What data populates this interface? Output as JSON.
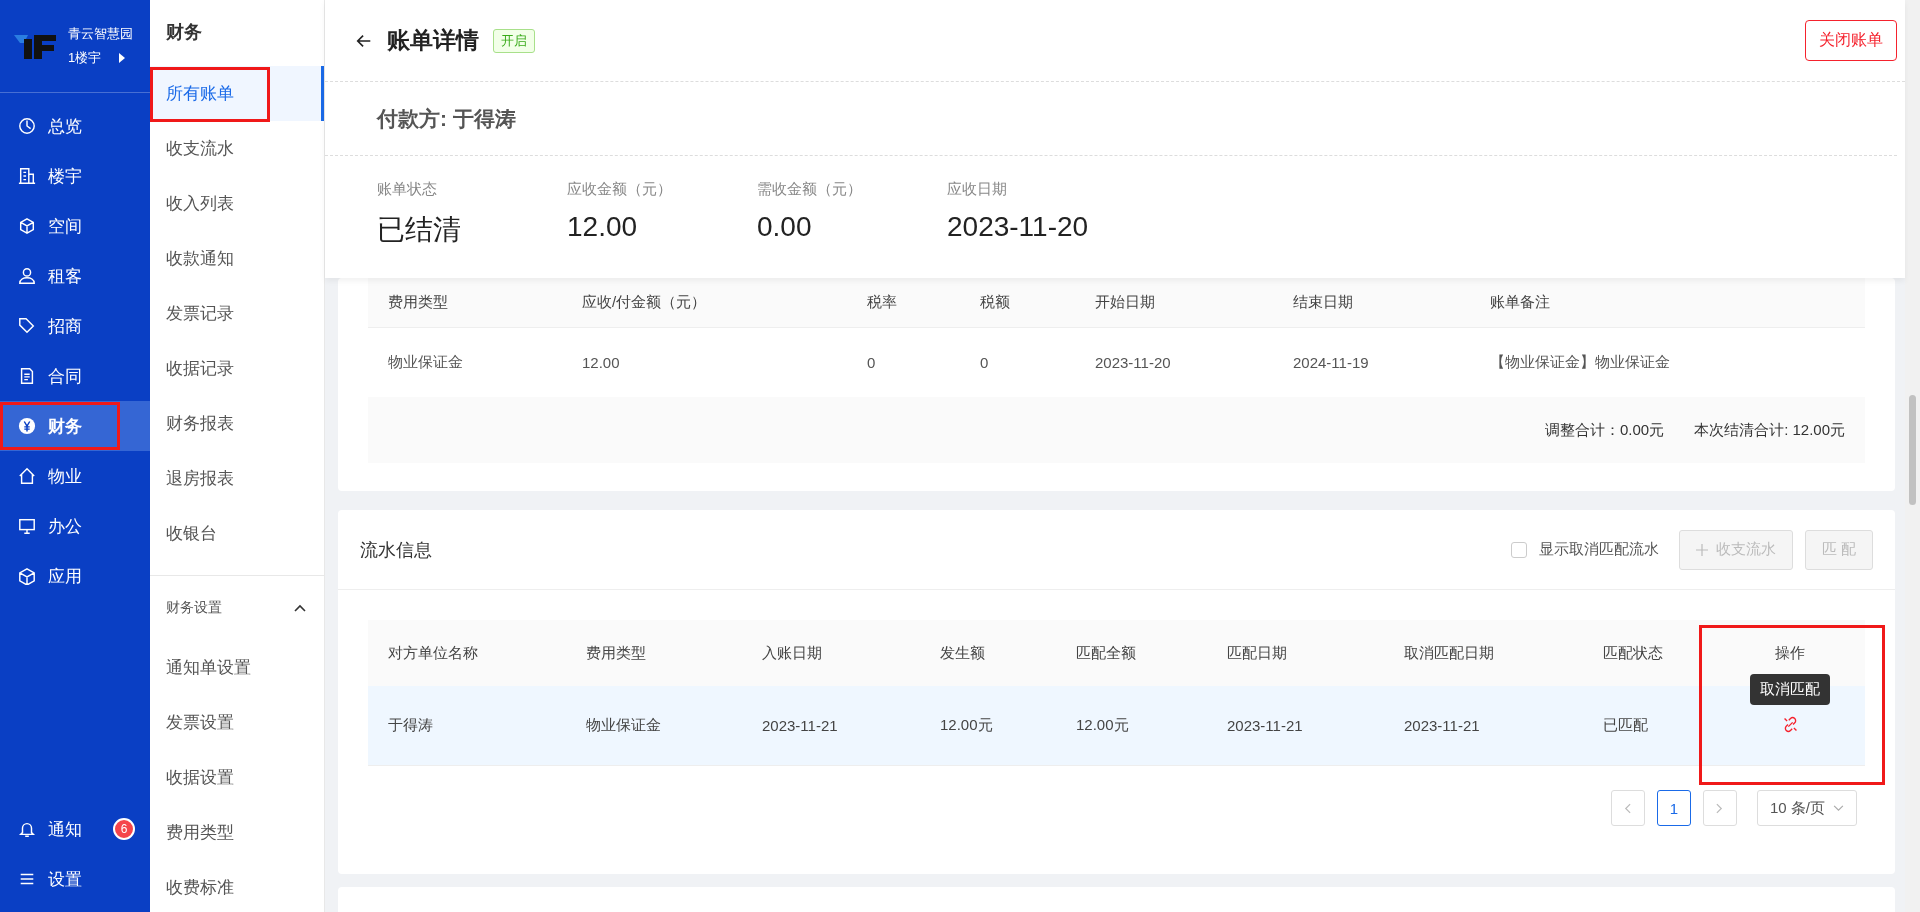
{
  "app": {
    "name": "青云智慧园",
    "building": "1楼宇"
  },
  "nav": {
    "items": [
      {
        "label": "总览",
        "selected": false,
        "highlighted": false
      },
      {
        "label": "楼宇",
        "selected": false,
        "highlighted": false
      },
      {
        "label": "空间",
        "selected": false,
        "highlighted": false
      },
      {
        "label": "租客",
        "selected": false,
        "highlighted": false
      },
      {
        "label": "招商",
        "selected": false,
        "highlighted": false
      },
      {
        "label": "合同",
        "selected": false,
        "highlighted": false
      },
      {
        "label": "财务",
        "selected": true,
        "highlighted": true
      },
      {
        "label": "物业",
        "selected": false,
        "highlighted": false
      },
      {
        "label": "办公",
        "selected": false,
        "highlighted": false
      },
      {
        "label": "应用",
        "selected": false,
        "highlighted": false
      }
    ],
    "bottom": [
      {
        "label": "通知",
        "badge": "6"
      },
      {
        "label": "设置"
      }
    ]
  },
  "submenu": {
    "title": "财务",
    "items": [
      {
        "label": "所有账单",
        "selected": true,
        "highlighted": true
      },
      {
        "label": "收支流水",
        "selected": false,
        "highlighted": false
      },
      {
        "label": "收入列表",
        "selected": false,
        "highlighted": false
      },
      {
        "label": "收款通知",
        "selected": false,
        "highlighted": false
      },
      {
        "label": "发票记录",
        "selected": false,
        "highlighted": false
      },
      {
        "label": "收据记录",
        "selected": false,
        "highlighted": false
      },
      {
        "label": "财务报表",
        "selected": false,
        "highlighted": false
      },
      {
        "label": "退房报表",
        "selected": false,
        "highlighted": false
      },
      {
        "label": "收银台",
        "selected": false,
        "highlighted": false
      }
    ],
    "group": {
      "label": "财务设置",
      "expanded": true,
      "items": [
        "通知单设置",
        "发票设置",
        "收据设置",
        "费用类型",
        "收费标准"
      ]
    }
  },
  "header": {
    "title": "账单详情",
    "tag": "开启",
    "close_button": "关闭账单",
    "payer": "付款方: 于得涛",
    "stats": [
      {
        "label": "账单状态",
        "value": "已结清"
      },
      {
        "label": "应收金额（元）",
        "value": "12.00"
      },
      {
        "label": "需收金额（元）",
        "value": "0.00"
      },
      {
        "label": "应收日期",
        "value": "2023-11-20"
      }
    ]
  },
  "fee_table": {
    "columns": [
      "费用类型",
      "应收/付金额（元）",
      "税率",
      "税额",
      "开始日期",
      "结束日期",
      "账单备注"
    ],
    "rows": [
      [
        "物业保证金",
        "12.00",
        "0",
        "0",
        "2023-11-20",
        "2024-11-19",
        "【物业保证金】物业保证金"
      ]
    ],
    "summary": [
      "调整合计：0.00元",
      "本次结清合计: 12.00元"
    ]
  },
  "flow": {
    "title": "流水信息",
    "show_cancelled": {
      "label": "显示取消匹配流水",
      "checked": false
    },
    "buttons": [
      {
        "label": "收支流水",
        "kind": "add",
        "disabled": true
      },
      {
        "label": "匹 配",
        "kind": "plain",
        "disabled": true
      }
    ],
    "table": {
      "columns": [
        "对方单位名称",
        "费用类型",
        "入账日期",
        "发生额",
        "匹配全额",
        "匹配日期",
        "取消匹配日期",
        "匹配状态",
        "操作"
      ],
      "action_column_highlighted": true,
      "rows": [
        {
          "cells": [
            "于得涛",
            "物业保证金",
            "2023-11-21",
            "12.00元",
            "12.00元",
            "2023-11-21",
            "2023-11-21",
            "已匹配"
          ],
          "hovered": true,
          "tooltip": "取消匹配"
        }
      ]
    },
    "pagination": {
      "pages": [
        {
          "label": "1",
          "selected": true
        }
      ],
      "page_size": "10 条/页"
    }
  }
}
